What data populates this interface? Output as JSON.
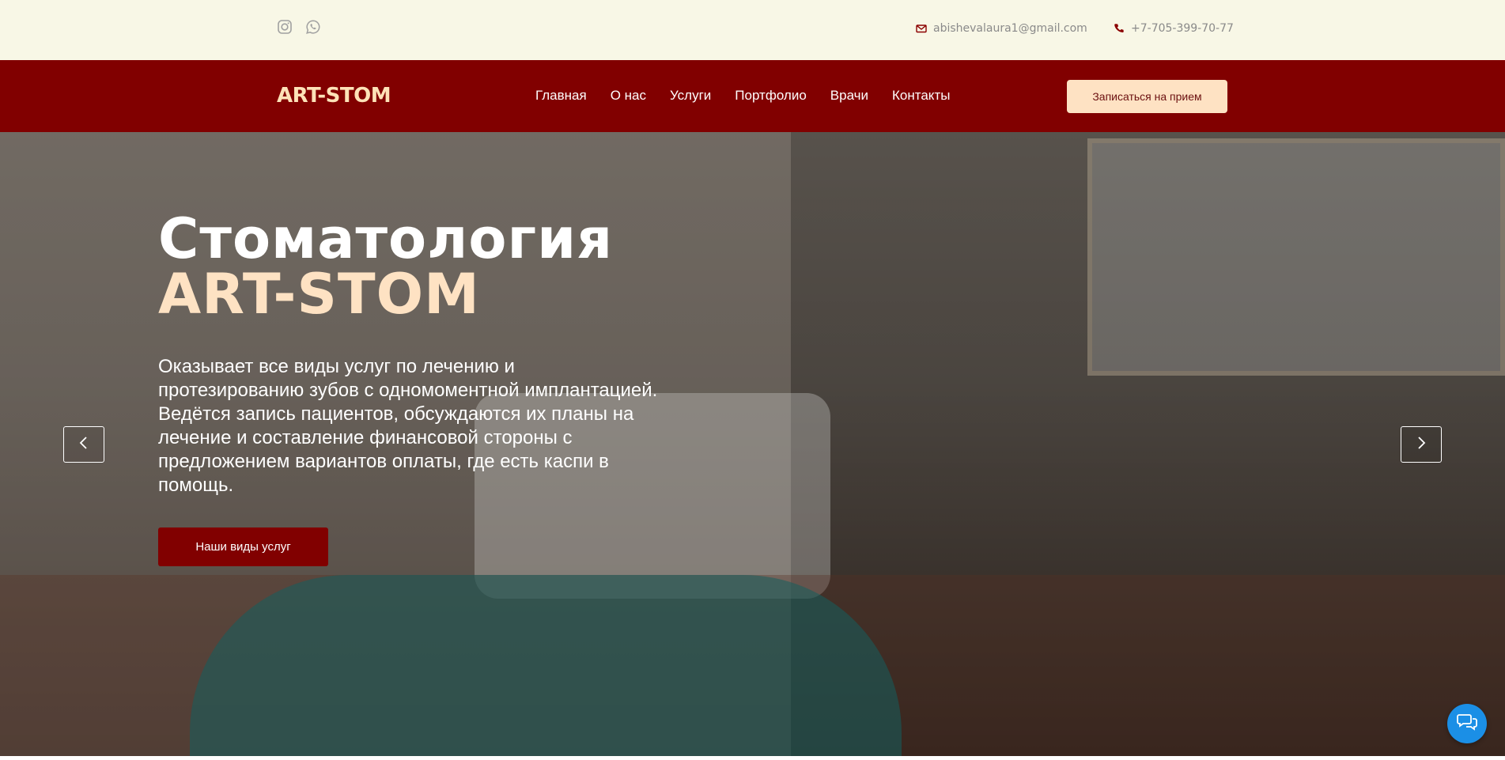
{
  "topbar": {
    "social": [
      {
        "icon": "instagram-icon"
      },
      {
        "icon": "whatsapp-icon"
      }
    ],
    "email": "abishevalaura1@gmail.com",
    "phone": "+7-705-399-70-77"
  },
  "navbar": {
    "logo": "ART-STOM",
    "links": [
      "Главная",
      "О нас",
      "Услуги",
      "Портфолио",
      "Врачи",
      "Контакты"
    ],
    "cta": "Записаться на прием"
  },
  "hero": {
    "title_line1": "Стоматология",
    "title_line2": "ART-STOM",
    "description": "Оказывает все виды услуг по лечению и протезированию зубов с одномоментной имплантацией. Ведётся запись пациентов, обсуждаются их планы на лечение и составление финансовой стороны с предложением вариантов оплаты, где есть каспи в помощь.",
    "button": "Наши виды услуг"
  },
  "colors": {
    "brand": "#810000",
    "accent": "#fee2c3",
    "topbar_bg": "#f8f7e6",
    "chat": "#1b8fe6"
  }
}
